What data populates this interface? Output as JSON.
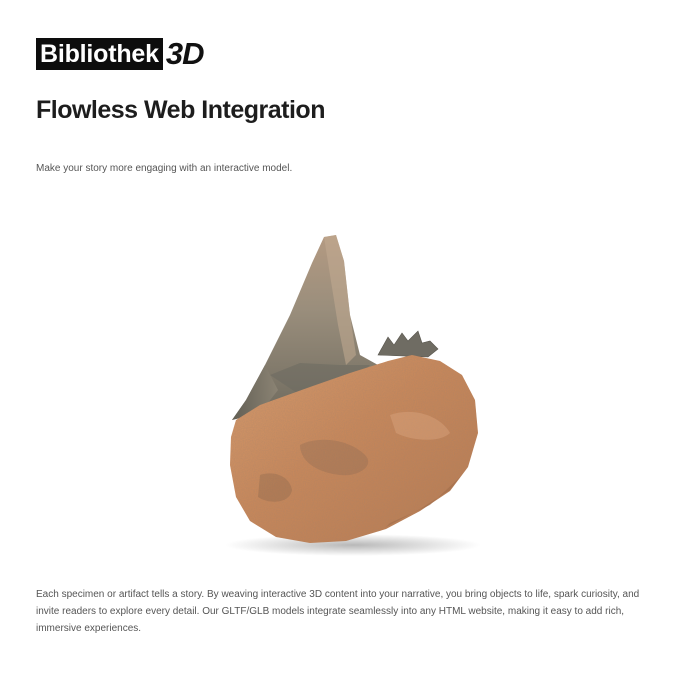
{
  "brand": {
    "name": "Bibliothek",
    "suffix": "3D"
  },
  "page": {
    "title": "Flowless Web Integration",
    "subtitle": "Make your story more engaging with an interactive model.",
    "body": "Each specimen or artifact tells a story. By weaving interactive 3D content into your narrative, you bring objects to life, spark curiosity, and invite readers to explore every detail. Our GLTF/GLB models integrate seamlessly into any HTML website, making it easy to add rich, immersive experiences."
  },
  "model": {
    "name": "fossil-shark-tooth-on-rock"
  },
  "colors": {
    "logo_bg": "#0d0d0d",
    "text": "#1d1d1d",
    "muted_text": "#555555",
    "rock": "#c98a5e",
    "tooth": "#8a8272"
  }
}
